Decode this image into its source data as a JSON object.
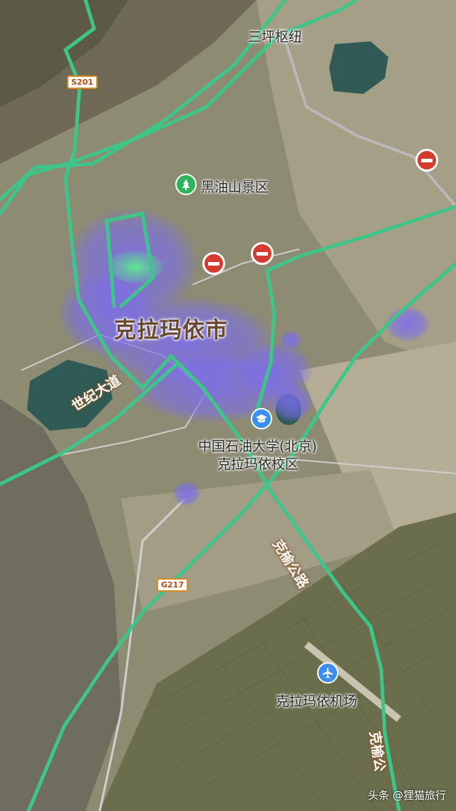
{
  "map": {
    "city": "克拉玛依市",
    "places": {
      "sanping": "三坪枢纽",
      "heiyoushan": "黑油山景区",
      "university_line1": "中国石油大学(北京)",
      "university_line2": "克拉玛依校区",
      "airport": "克拉玛依机场"
    },
    "roads": {
      "shiji": "世纪大道",
      "keyu_1": "克榆公路",
      "keyu_2": "克榆公"
    },
    "shields": {
      "s201": "S201",
      "g217": "G217"
    },
    "colors": {
      "road": "#3fc48a",
      "heat": "#7b6cf0",
      "water": "#2f5a55",
      "closure": "#d63b2f",
      "poi_green": "#2db55d",
      "poi_blue": "#3a8ff0"
    }
  },
  "watermark": "头条 @狸猫旅行"
}
